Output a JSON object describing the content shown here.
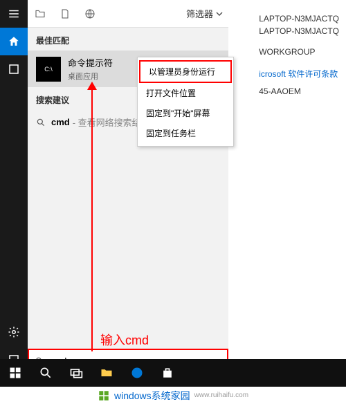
{
  "right": {
    "device1": "LAPTOP-N3MJACTQ",
    "device2": "LAPTOP-N3MJACTQ",
    "workgroup": "WORKGROUP",
    "license_link": "icrosoft 软件许可条款",
    "product_id": "45-AAOEM"
  },
  "header": {
    "filter": "筛选器"
  },
  "sections": {
    "best_match": "最佳匹配",
    "suggestions": "搜索建议"
  },
  "result": {
    "title": "命令提示符",
    "subtitle": "桌面应用",
    "icon_label": "C:\\"
  },
  "suggestion": {
    "bold": "cmd",
    "gray": "- 查看网络搜索结果"
  },
  "context_menu": {
    "run_admin": "以管理员身份运行",
    "open_location": "打开文件位置",
    "pin_start": "固定到\"开始\"屏幕",
    "pin_taskbar": "固定到任务栏"
  },
  "search": {
    "value": "cmd"
  },
  "annotation": {
    "arrow_label": "输入cmd"
  },
  "watermark": {
    "text": "windows系统家园",
    "url": "www.ruihaifu.com"
  }
}
